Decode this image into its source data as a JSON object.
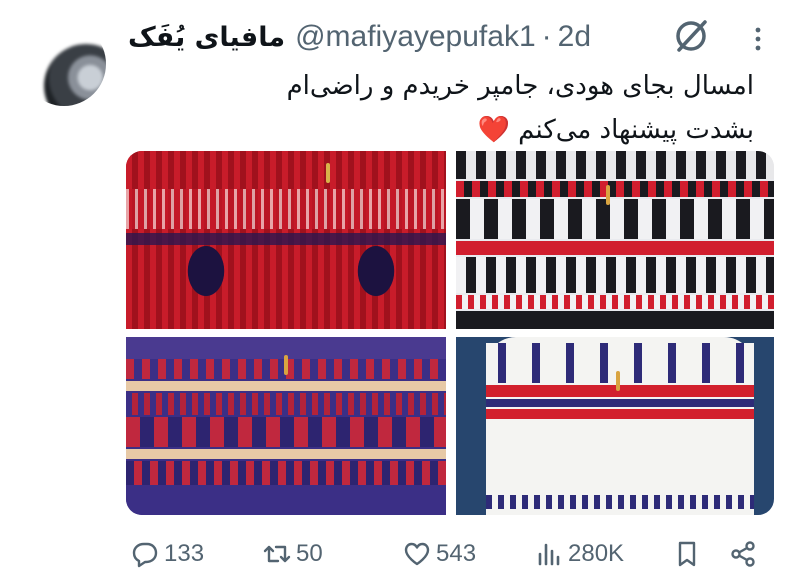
{
  "tweet": {
    "display_name": "مافیای یُفَک",
    "handle": "@mafiyayepufak1",
    "separator": "·",
    "time": "2d",
    "text_line1": "امسال بجای هودی، جامپر خریدم و راضی‌ام",
    "text_line2": "بشدت پیشنهاد می‌کنم",
    "text_emoji": "❤️"
  },
  "icons": {
    "avatar": "avatar-blurred",
    "grok": "grok-icon",
    "more": "more-dots-icon"
  },
  "media": {
    "images": [
      {
        "name": "red-paisley-sweater"
      },
      {
        "name": "black-red-fairisle-sweater"
      },
      {
        "name": "blue-red-fairisle-sweater"
      },
      {
        "name": "white-snowflake-sweater"
      }
    ]
  },
  "actions": {
    "replies": "133",
    "reposts": "50",
    "likes": "543",
    "views": "280K"
  },
  "colors": {
    "text": "#0f1419",
    "secondary": "#536471",
    "heart": "#f0305a"
  }
}
